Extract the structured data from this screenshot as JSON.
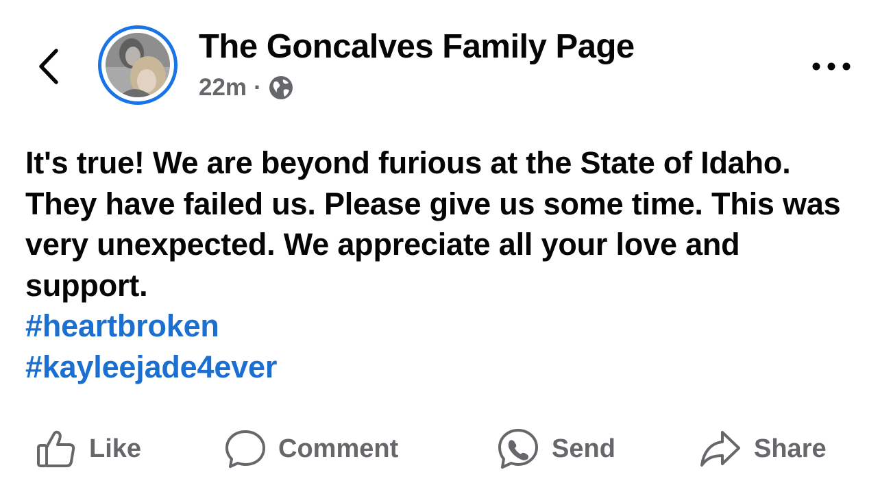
{
  "header": {
    "back_icon": "chevron-left-icon",
    "page_name": "The Goncalves Family Page",
    "timestamp": "22m",
    "separator": "·",
    "audience_icon": "globe-icon",
    "more_icon": "ellipsis-icon"
  },
  "post": {
    "text": "It's true! We are beyond furious at the State of Idaho. They have failed us. Please give us some time. This was very unexpected. We appreciate all your love and support.",
    "hashtags": [
      "#heartbroken",
      "#kayleejade4ever"
    ]
  },
  "actions": [
    {
      "label": "Like",
      "icon": "thumbs-up-icon"
    },
    {
      "label": "Comment",
      "icon": "comment-bubble-icon"
    },
    {
      "label": "Send",
      "icon": "messenger-icon"
    },
    {
      "label": "Share",
      "icon": "share-arrow-icon"
    }
  ],
  "colors": {
    "accent_blue": "#1b74e4",
    "hashtag_blue": "#1a6fd0",
    "secondary_gray": "#65676b",
    "text_black": "#050505"
  }
}
